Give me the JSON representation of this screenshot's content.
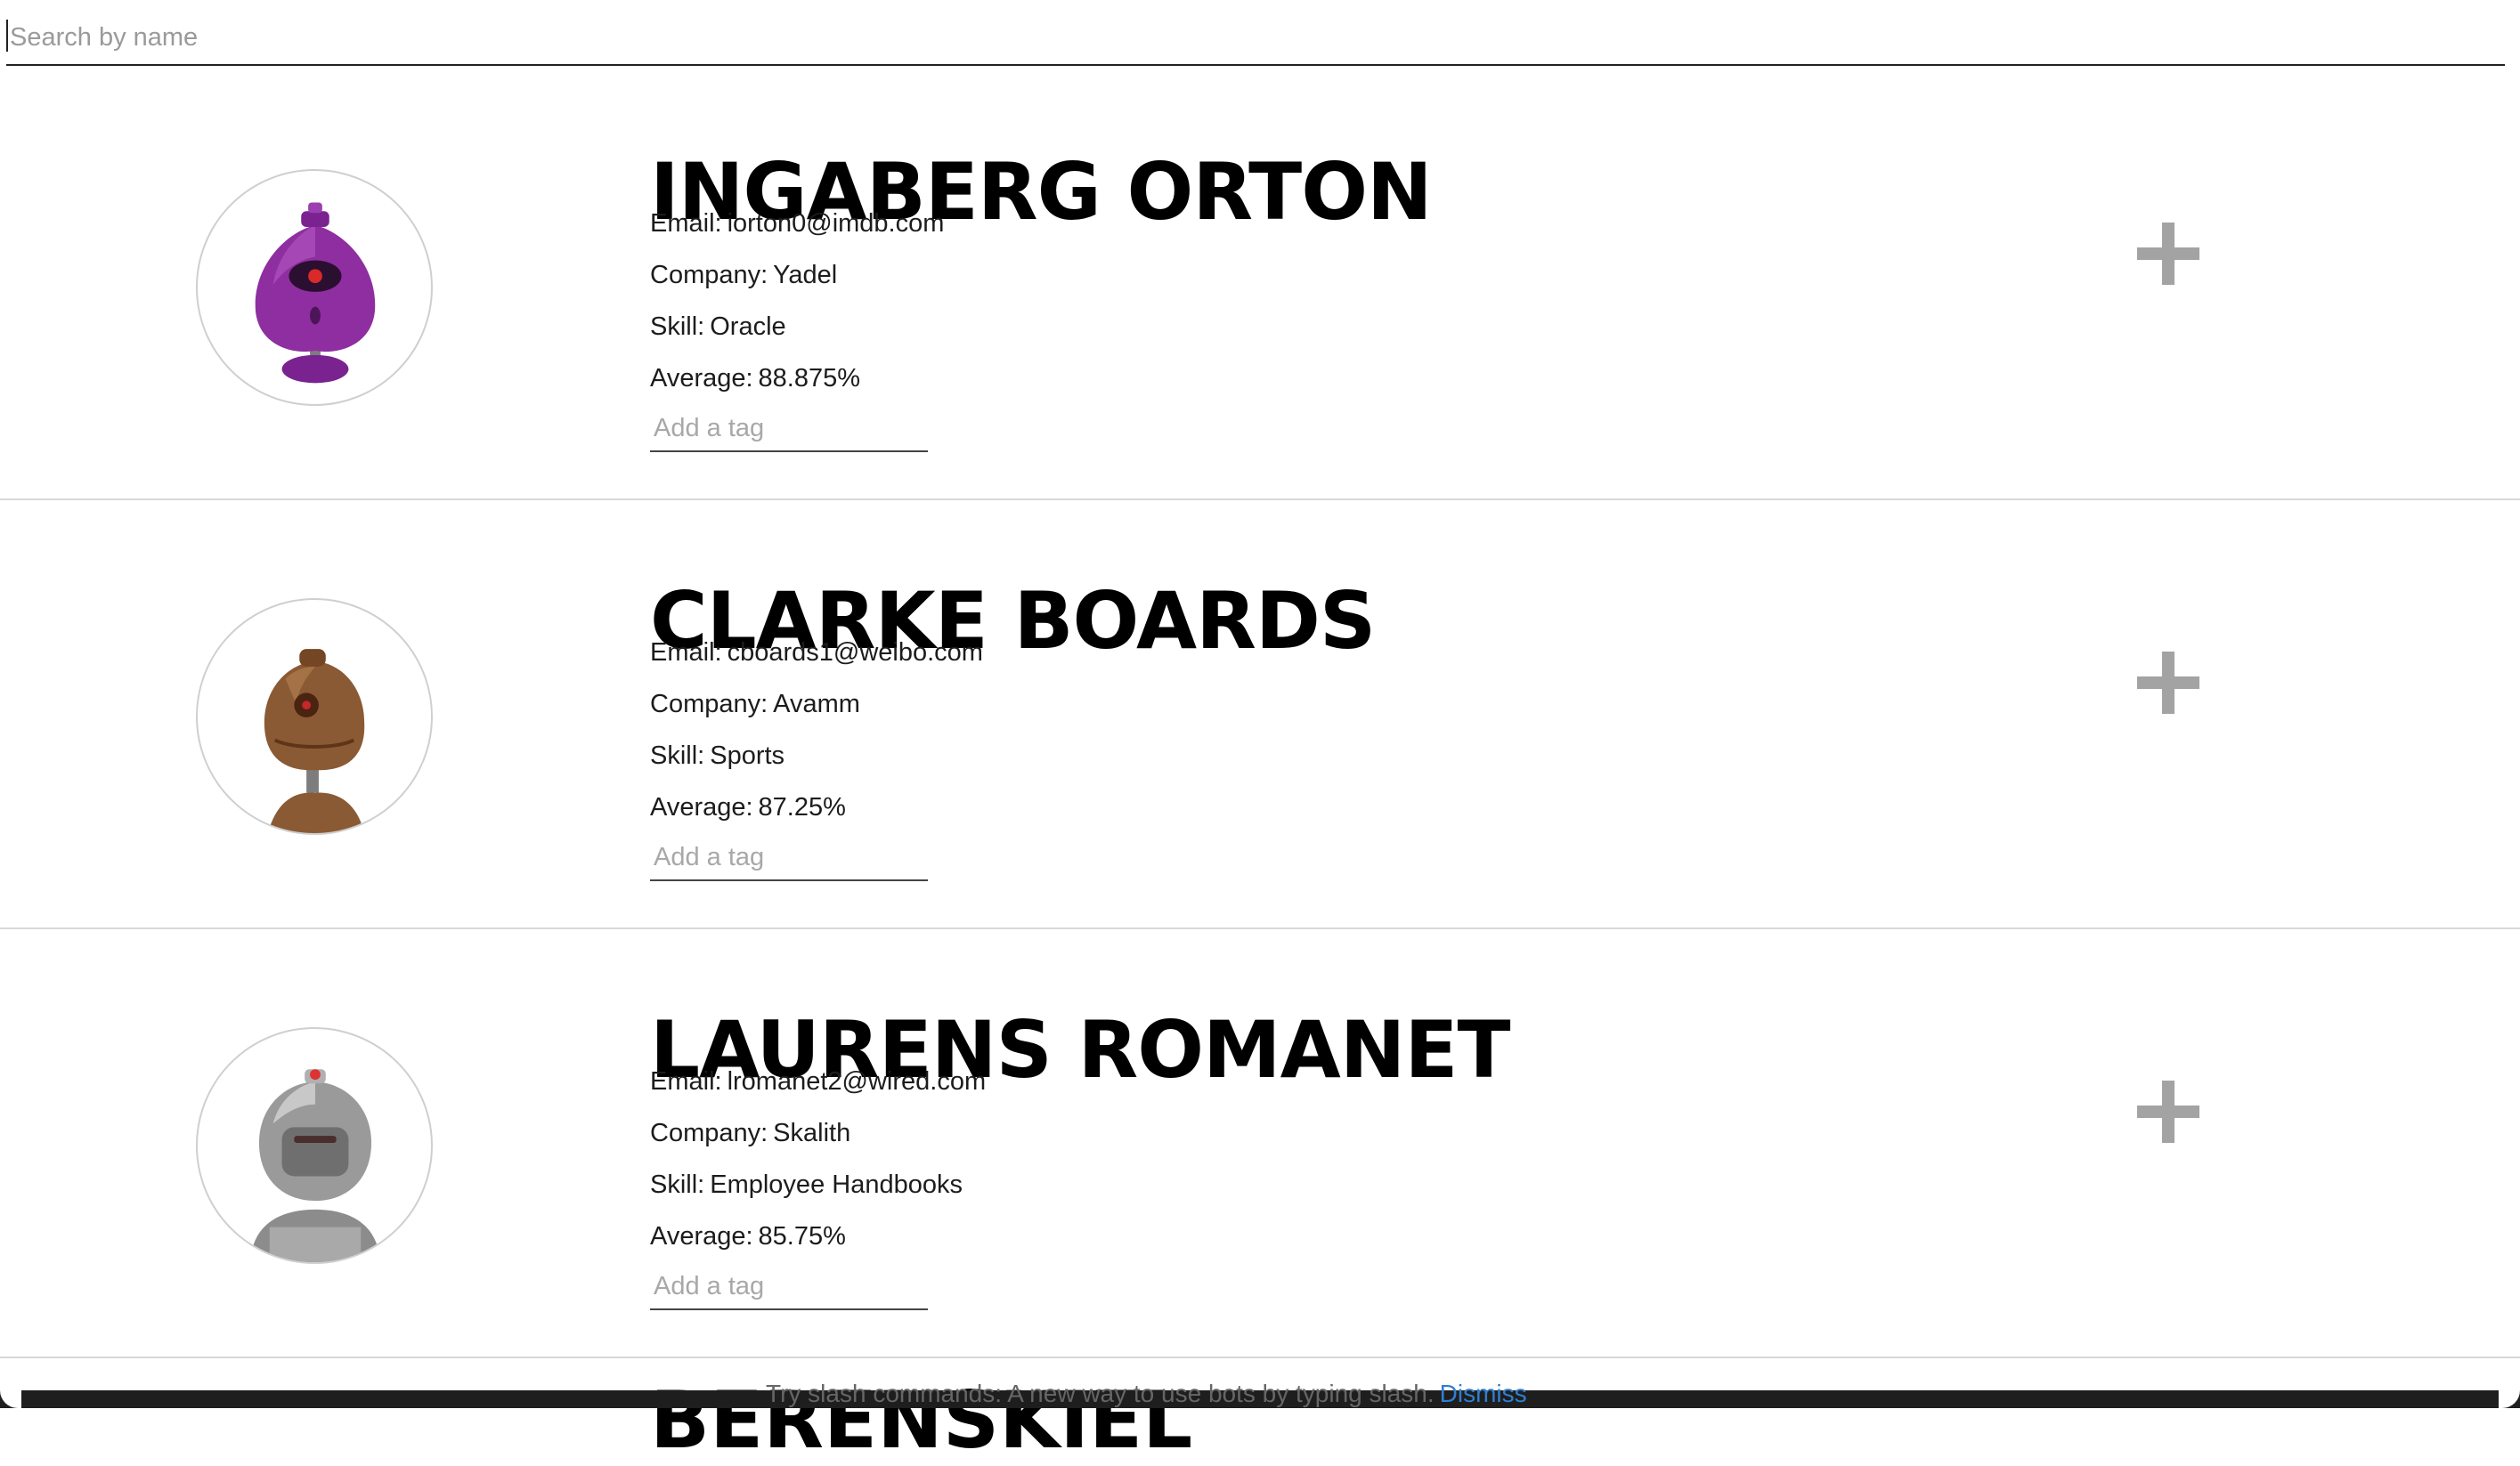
{
  "search": {
    "placeholder": "Search by name",
    "value": ""
  },
  "students": [
    {
      "name": "INGABERG ORTON",
      "email_label": "Email:",
      "email": "iorton0@imdb.com",
      "company_label": "Company:",
      "company": "Yadel",
      "skill_label": "Skill:",
      "skill": "Oracle",
      "average_label": "Average:",
      "average": "88.875%",
      "tag_placeholder": "Add a tag",
      "avatar_icon": "purple-robot-icon",
      "avatar_color": "#8e2ea0"
    },
    {
      "name": "CLARKE BOARDS",
      "email_label": "Email:",
      "email": "cboards1@weibo.com",
      "company_label": "Company:",
      "company": "Avamm",
      "skill_label": "Skill:",
      "skill": "Sports",
      "average_label": "Average:",
      "average": "87.25%",
      "tag_placeholder": "Add a tag",
      "avatar_icon": "brown-robot-icon",
      "avatar_color": "#8a5a34"
    },
    {
      "name": "LAURENS ROMANET",
      "email_label": "Email:",
      "email": "lromanet2@wired.com",
      "company_label": "Company:",
      "company": "Skalith",
      "skill_label": "Skill:",
      "skill": "Employee Handbooks",
      "average_label": "Average:",
      "average": "85.75%",
      "tag_placeholder": "Add a tag",
      "avatar_icon": "gray-robot-icon",
      "avatar_color": "#9a9a9a"
    }
  ],
  "expand_icon": "plus-icon",
  "partial_next_name": "BERENSKIEL",
  "bottom_hint": {
    "text": "Try slash commands: A new way to use bots by typing slash.",
    "dismiss": "Dismiss"
  }
}
